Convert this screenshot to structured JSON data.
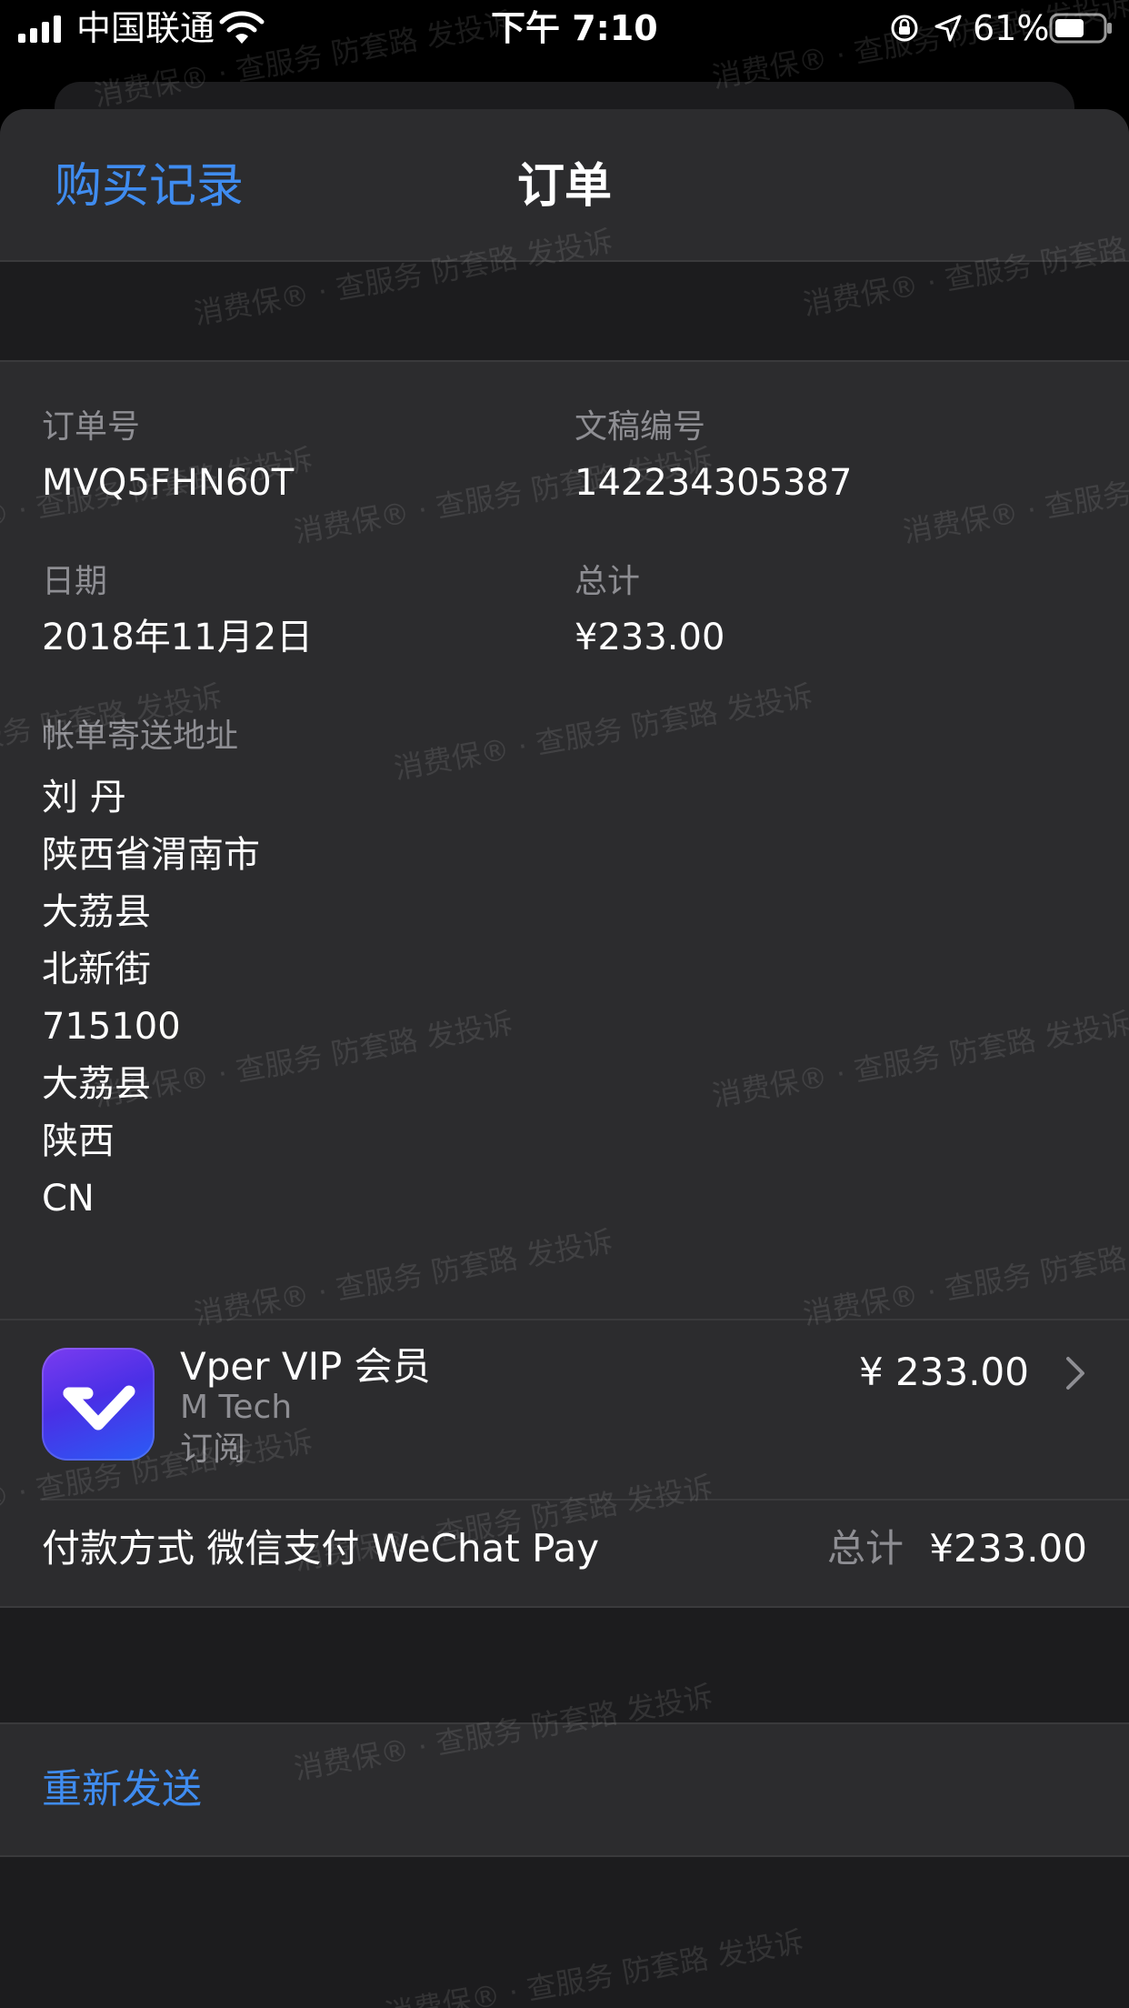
{
  "status_bar": {
    "carrier": "中国联通",
    "time": "下午 7:10",
    "battery": "61%"
  },
  "nav": {
    "back_label": "购买记录",
    "title": "订单"
  },
  "order": {
    "order_no_label": "订单号",
    "order_no": "MVQ5FHN60T",
    "doc_no_label": "文稿编号",
    "doc_no": "142234305387",
    "date_label": "日期",
    "date": "2018年11月2日",
    "total_label": "总计",
    "total": "¥233.00",
    "billing_label": "帐单寄送地址",
    "address": [
      "刘 丹",
      "陕西省渭南市",
      "大荔县",
      "北新街",
      "715100",
      "大荔县",
      "陕西",
      "CN"
    ]
  },
  "purchase": {
    "app_name": "Vper VIP 会员",
    "developer": "M Tech",
    "type": "订阅",
    "price": "¥ 233.00",
    "payment_method": "付款方式 微信支付 WeChat Pay",
    "total_label": "总计",
    "total": "¥233.00"
  },
  "actions": {
    "resend": "重新发送"
  },
  "watermark": "消费保® · 查服务 防套路 发投诉",
  "colors": {
    "accent": "#3f8cf0",
    "background": "#1c1c1e",
    "cell": "#2c2c2e",
    "secondary_text": "#8e8e93"
  }
}
